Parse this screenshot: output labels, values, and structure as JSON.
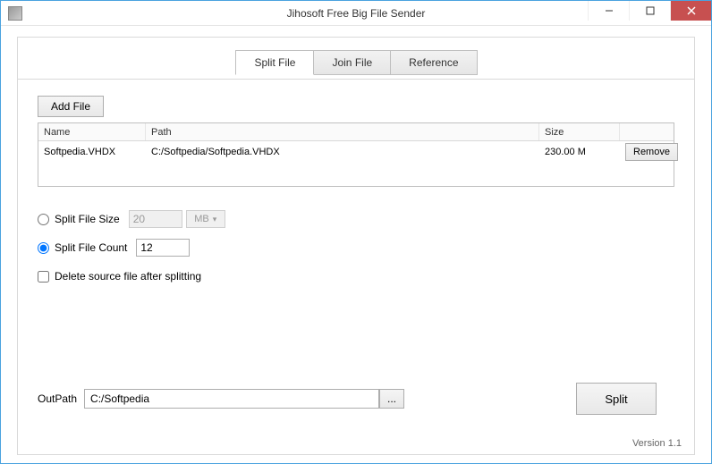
{
  "window": {
    "title": "Jihosoft Free Big File Sender"
  },
  "tabs": [
    {
      "label": "Split File",
      "active": true
    },
    {
      "label": "Join File",
      "active": false
    },
    {
      "label": "Reference",
      "active": false
    }
  ],
  "buttons": {
    "add_file": "Add File",
    "remove": "Remove",
    "browse": "...",
    "split": "Split"
  },
  "file_table": {
    "headers": {
      "name": "Name",
      "path": "Path",
      "size": "Size"
    },
    "rows": [
      {
        "name": "Softpedia.VHDX",
        "path": "C:/Softpedia/Softpedia.VHDX",
        "size": "230.00 M"
      }
    ]
  },
  "options": {
    "split_size": {
      "label": "Split File Size",
      "value": "20",
      "unit": "MB",
      "selected": false
    },
    "split_count": {
      "label": "Split File Count",
      "value": "12",
      "selected": true
    },
    "delete_source": {
      "label": "Delete source file after splitting",
      "checked": false
    }
  },
  "output": {
    "label": "OutPath",
    "value": "C:/Softpedia"
  },
  "footer": {
    "version": "Version 1.1"
  }
}
